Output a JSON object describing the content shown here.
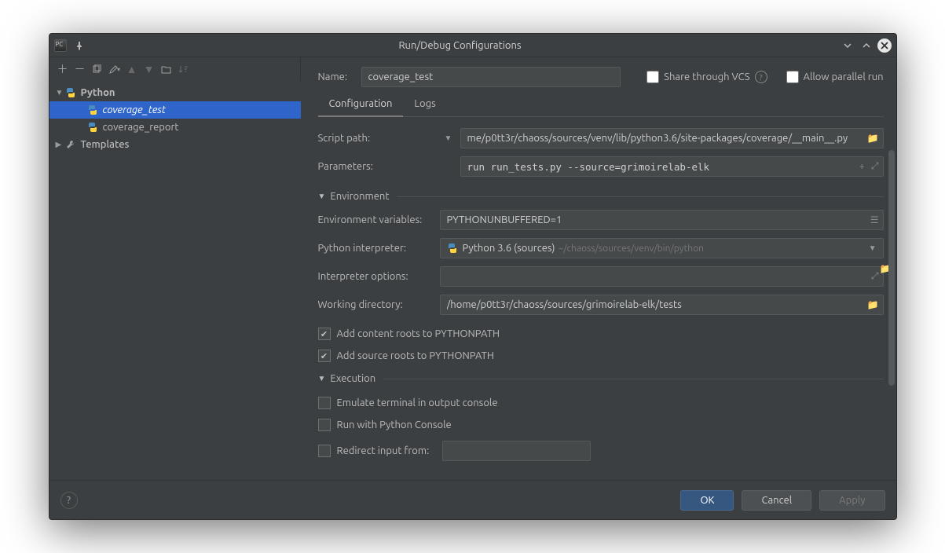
{
  "window": {
    "title": "Run/Debug Configurations"
  },
  "tree": {
    "python_label": "Python",
    "items": [
      "coverage_test",
      "coverage_report"
    ],
    "templates_label": "Templates"
  },
  "form": {
    "name_label": "Name:",
    "name_value": "coverage_test",
    "share_label": "Share through VCS",
    "parallel_label": "Allow parallel run",
    "tabs": {
      "config": "Configuration",
      "logs": "Logs"
    },
    "script_label": "Script path:",
    "script_value": "me/p0tt3r/chaoss/sources/venv/lib/python3.6/site-packages/coverage/__main__.py",
    "params_label": "Parameters:",
    "params_value": "run run_tests.py --source=grimoirelab-elk",
    "env_header": "Environment",
    "envvars_label": "Environment variables:",
    "envvars_value": "PYTHONUNBUFFERED=1",
    "interp_label": "Python interpreter:",
    "interp_name": "Python 3.6 (sources)",
    "interp_path": "~/chaoss/sources/venv/bin/python",
    "interp_opts_label": "Interpreter options:",
    "interp_opts_value": "",
    "workdir_label": "Working directory:",
    "workdir_value": "/home/p0tt3r/chaoss/sources/grimoirelab-elk/tests",
    "chk_content_roots": "Add content roots to PYTHONPATH",
    "chk_source_roots": "Add source roots to PYTHONPATH",
    "exec_header": "Execution",
    "chk_emulate": "Emulate terminal in output console",
    "chk_pyconsole": "Run with Python Console",
    "chk_redirect": "Redirect input from:"
  },
  "buttons": {
    "ok": "OK",
    "cancel": "Cancel",
    "apply": "Apply"
  }
}
